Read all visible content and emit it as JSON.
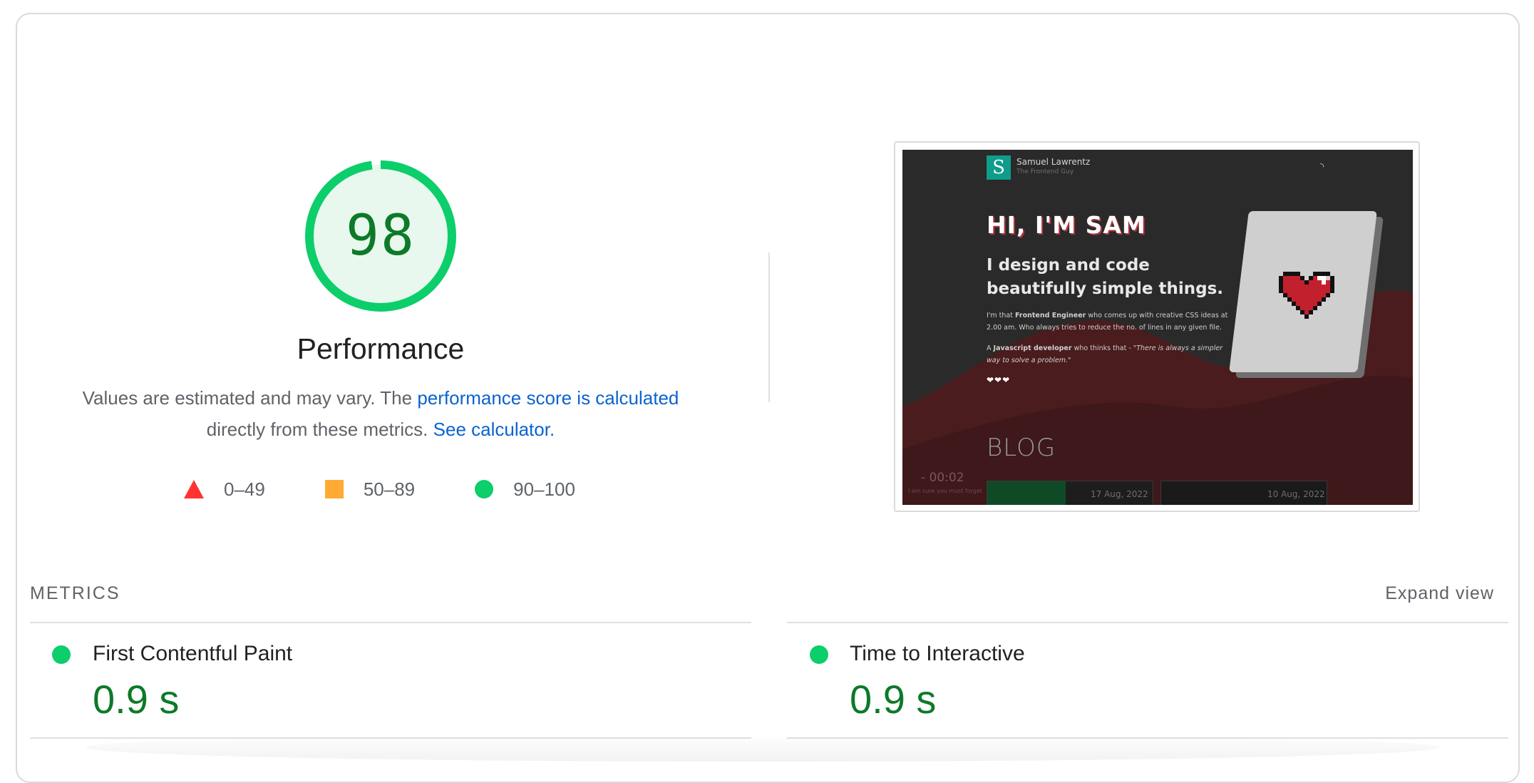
{
  "score": {
    "value": "98",
    "title": "Performance",
    "numeric": 98,
    "color": "#0cce6b",
    "text_color": "#0c7a29"
  },
  "description": {
    "prefix": "Values are estimated and may vary. The ",
    "link1": "performance score is calculated",
    "middle": " directly from these metrics. ",
    "link2": "See calculator."
  },
  "legend": {
    "fail": "0–49",
    "average": "50–89",
    "pass": "90–100",
    "fail_color": "#ff3333",
    "average_color": "#ffaa33",
    "pass_color": "#0cce6b"
  },
  "screenshot": {
    "site_name": "Samuel Lawrentz",
    "site_tag": "The Frontend Guy",
    "logo_letter": "S",
    "headline": "HI, I'M SAM",
    "subheadline": "I design and code beautifully simple things.",
    "para1_pre": "I'm that ",
    "para1_bold": "Frontend Engineer",
    "para1_post": " who comes up with creative CSS ideas at 2.00 am. Who always tries to reduce the no. of lines in any given file.",
    "para2_pre": "A ",
    "para2_bold": "Javascript developer",
    "para2_mid": " who thinks that - ",
    "para2_quote": "\"There is always a simpler way to solve a problem.\"",
    "hearts": "❤❤❤",
    "blog": "BLOG",
    "time": "- 00:02",
    "time_caption": "I am sure you must forget",
    "date1": "17 Aug, 2022",
    "date2": "10 Aug, 2022"
  },
  "metrics": {
    "label": "METRICS",
    "expand": "Expand view",
    "items": [
      {
        "name": "First Contentful Paint",
        "value": "0.9 s"
      },
      {
        "name": "Time to Interactive",
        "value": "0.9 s"
      }
    ]
  }
}
